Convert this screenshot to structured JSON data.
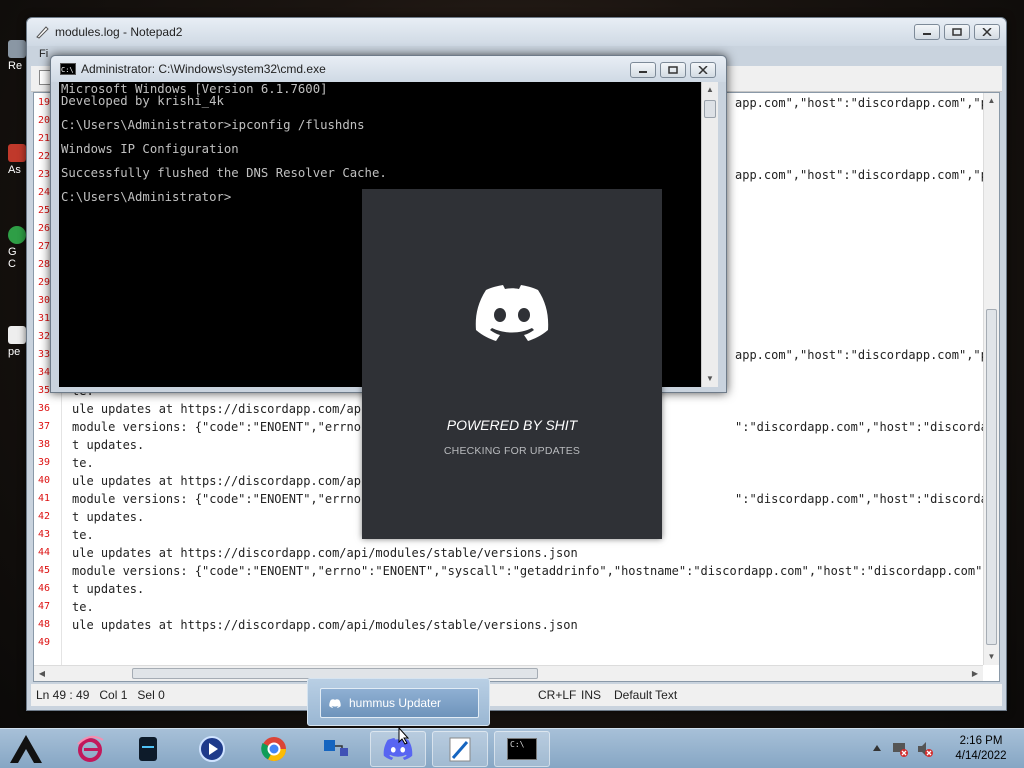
{
  "desktop": {
    "icon_labels": [
      "Re",
      "As",
      "G",
      "C",
      "pe"
    ]
  },
  "notepad": {
    "title": "modules.log - Notepad2",
    "menu_first": "Fi",
    "lines": [
      {
        "n": "19",
        "left": "",
        "right": "app.com\",\"host\":\"discordapp.com\",\"por"
      },
      {
        "n": "20",
        "left": "",
        "right": ""
      },
      {
        "n": "21",
        "left": "",
        "right": ""
      },
      {
        "n": "22",
        "left": "",
        "right": ""
      },
      {
        "n": "23",
        "left": "",
        "right": "app.com\",\"host\":\"discordapp.com\",\"por"
      },
      {
        "n": "24",
        "left": "",
        "right": ""
      },
      {
        "n": "25",
        "left": "",
        "right": ""
      },
      {
        "n": "26",
        "left": "",
        "right": ""
      },
      {
        "n": "27",
        "left": "",
        "right": ""
      },
      {
        "n": "28",
        "left": "",
        "right": ""
      },
      {
        "n": "29",
        "left": "",
        "right": ""
      },
      {
        "n": "30",
        "left": "",
        "right": ""
      },
      {
        "n": "31",
        "left": "",
        "right": ""
      },
      {
        "n": "32",
        "left": "",
        "right": ""
      },
      {
        "n": "33",
        "left": "",
        "right": "app.com\",\"host\":\"discordapp.com\",\"por"
      },
      {
        "n": "34",
        "left": "",
        "right": ""
      },
      {
        "n": "35",
        "left": "te.",
        "right": ""
      },
      {
        "n": "36",
        "left": "ule updates at https://discordapp.com/api/",
        "right": ""
      },
      {
        "n": "37",
        "left": "module versions: {\"code\":\"ENOENT\",\"errno\":",
        "right": "\":\"discordapp.com\",\"host\":\"discordapp.com\",\"por"
      },
      {
        "n": "38",
        "left": "t updates.",
        "right": ""
      },
      {
        "n": "39",
        "left": "te.",
        "right": ""
      },
      {
        "n": "40",
        "left": "ule updates at https://discordapp.com/api/",
        "right": ""
      },
      {
        "n": "41",
        "left": "module versions: {\"code\":\"ENOENT\",\"errno\":",
        "right": "\":\"discordapp.com\",\"host\":\"discordapp.com\",\"por"
      },
      {
        "n": "42",
        "left": "t updates.",
        "right": ""
      },
      {
        "n": "43",
        "left": "te.",
        "right": ""
      },
      {
        "n": "44",
        "left": "ule updates at https://discordapp.com/api/modules/stable/versions.json",
        "right": ""
      },
      {
        "n": "45",
        "left": "module versions: {\"code\":\"ENOENT\",\"errno\":\"ENOENT\",\"syscall\":\"getaddrinfo\",\"hostname\":\"discordapp.com\",\"host\":\"discordapp.com\",\"por",
        "right": ""
      },
      {
        "n": "46",
        "left": "t updates.",
        "right": ""
      },
      {
        "n": "47",
        "left": "te.",
        "right": ""
      },
      {
        "n": "48",
        "left": "ule updates at https://discordapp.com/api/modules/stable/versions.json",
        "right": ""
      },
      {
        "n": "49",
        "left": "",
        "right": ""
      }
    ],
    "status": {
      "position": "Ln 49 : 49",
      "col": "Col 1",
      "sel": "Sel 0",
      "eol": "CR+LF",
      "ins": "INS",
      "scheme": "Default Text"
    }
  },
  "cmd": {
    "title": "Administrator: C:\\Windows\\system32\\cmd.exe",
    "icon_text": "C:\\",
    "lines": [
      "Microsoft Windows [Version 6.1.7600]",
      "Developed by krishi_4k",
      "",
      "C:\\Users\\Administrator>ipconfig /flushdns",
      "",
      "Windows IP Configuration",
      "",
      "Successfully flushed the DNS Resolver Cache.",
      "",
      "C:\\Users\\Administrator>"
    ]
  },
  "discord_splash": {
    "title": "POWERED BY SHIT",
    "subtitle": "CHECKING FOR UPDATES"
  },
  "taskbar": {
    "popup_item": "hummus Updater",
    "cmd_icon_text": "C:\\",
    "clock_time": "2:16 PM",
    "clock_date": "4/14/2022"
  }
}
